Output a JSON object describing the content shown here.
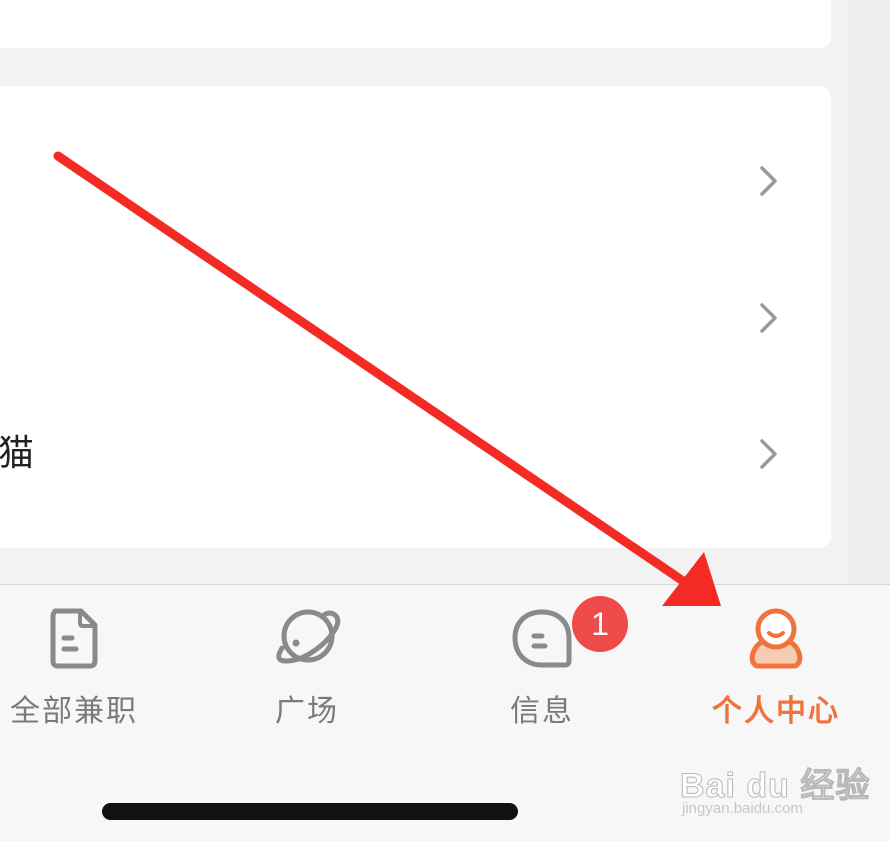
{
  "list": {
    "rows": [
      {
        "label": ""
      },
      {
        "label": ""
      },
      {
        "label": "猫"
      }
    ]
  },
  "tabbar": {
    "tabs": [
      {
        "label": "全部兼职",
        "icon": "document-icon",
        "active": false
      },
      {
        "label": "广场",
        "icon": "planet-icon",
        "active": false
      },
      {
        "label": "信息",
        "icon": "chat-bubble-icon",
        "active": false,
        "badge": "1"
      },
      {
        "label": "个人中心",
        "icon": "person-icon",
        "active": true
      }
    ]
  },
  "watermark": {
    "brand": "Bai du 经验",
    "url": "jingyan.baidu.com"
  },
  "colors": {
    "accent": "#f0733c",
    "badge": "#f04b4b",
    "annotation_arrow": "#f42b25",
    "inactive_icon": "#8a8a8a"
  }
}
